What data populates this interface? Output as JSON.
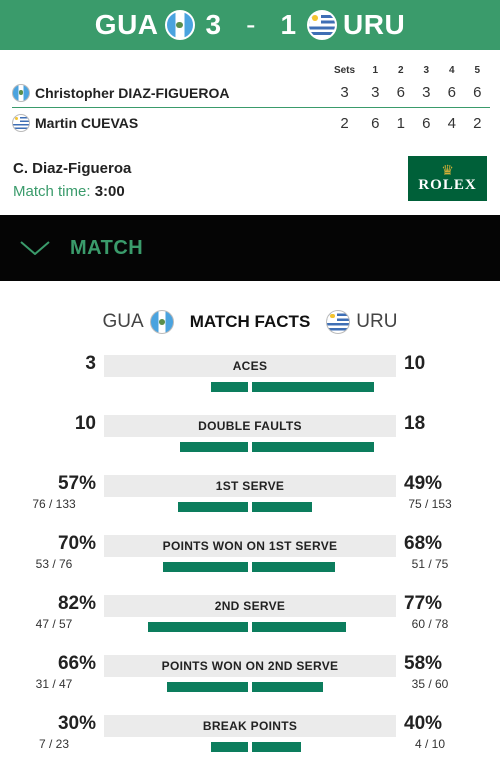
{
  "header": {
    "home_code": "GUA",
    "home_sets": "3",
    "separator": "-",
    "away_sets": "1",
    "away_code": "URU",
    "home_flag": "guatemala-flag",
    "away_flag": "uruguay-flag",
    "accent": "#3a9b6b"
  },
  "scoreboard": {
    "headers": [
      "Sets",
      "1",
      "2",
      "3",
      "4",
      "5"
    ],
    "players": [
      {
        "name": "Christopher DIAZ-FIGUEROA",
        "scores": [
          "3",
          "3",
          "6",
          "3",
          "6",
          "6"
        ]
      },
      {
        "name": "Martin CUEVAS",
        "scores": [
          "2",
          "6",
          "1",
          "6",
          "4",
          "2"
        ]
      }
    ]
  },
  "info": {
    "player": "C. Diaz-Figueroa",
    "time_label": "Match time:",
    "time_value": "3:00",
    "sponsor": "ROLEX"
  },
  "match_bar": {
    "label": "MATCH",
    "icon": "chevron-down-icon"
  },
  "facts": {
    "home_code": "GUA",
    "title": "MATCH FACTS",
    "away_code": "URU",
    "bar_color": "#0c7d5d",
    "stats": [
      {
        "label": "ACES",
        "left": "3",
        "left_sub": "",
        "right": "10",
        "right_sub": "",
        "left_value": 3,
        "right_value": 10,
        "max": 10
      },
      {
        "label": "DOUBLE FAULTS",
        "left": "10",
        "left_sub": "",
        "right": "18",
        "right_sub": "",
        "left_value": 10,
        "right_value": 18,
        "max": 18
      },
      {
        "label": "1ST SERVE",
        "left": "57%",
        "left_sub": "76 / 133",
        "right": "49%",
        "right_sub": "75 / 153",
        "left_value": 57,
        "right_value": 49,
        "max": 100
      },
      {
        "label": "POINTS WON ON 1ST SERVE",
        "left": "70%",
        "left_sub": "53 / 76",
        "right": "68%",
        "right_sub": "51 / 75",
        "left_value": 70,
        "right_value": 68,
        "max": 100
      },
      {
        "label": "2ND SERVE",
        "left": "82%",
        "left_sub": "47 / 57",
        "right": "77%",
        "right_sub": "60 / 78",
        "left_value": 82,
        "right_value": 77,
        "max": 100
      },
      {
        "label": "POINTS WON ON 2ND SERVE",
        "left": "66%",
        "left_sub": "31 / 47",
        "right": "58%",
        "right_sub": "35 / 60",
        "left_value": 66,
        "right_value": 58,
        "max": 100
      },
      {
        "label": "BREAK POINTS",
        "left": "30%",
        "left_sub": "7 / 23",
        "right": "40%",
        "right_sub": "4 / 10",
        "left_value": 30,
        "right_value": 40,
        "max": 100
      }
    ]
  }
}
